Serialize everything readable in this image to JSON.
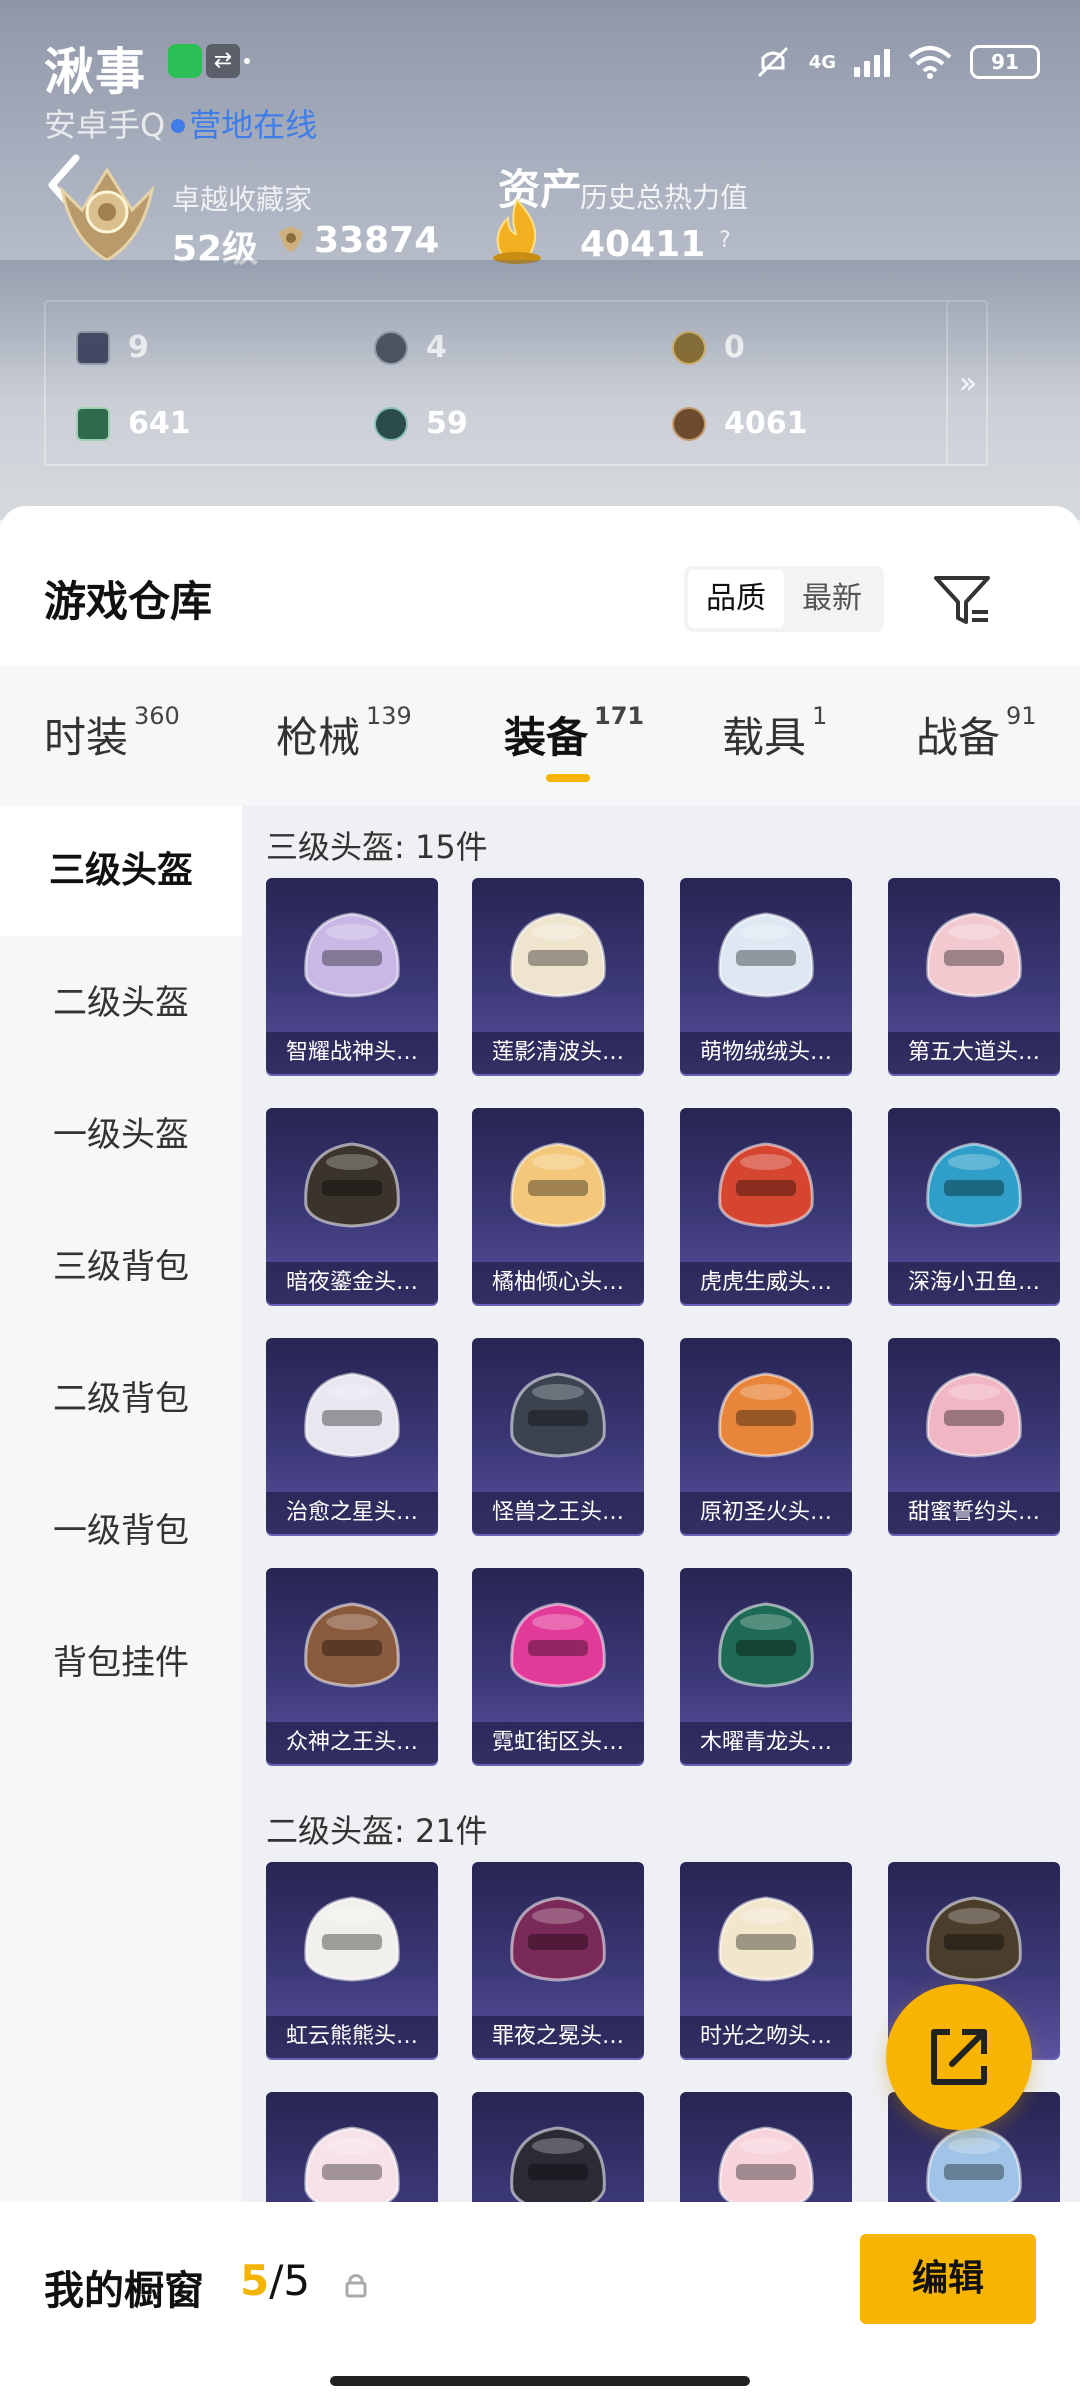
{
  "status_bar": {
    "clock": "湫事",
    "network": "4G",
    "battery": "91"
  },
  "header": {
    "account": "安卓手Q",
    "online": "营地在线",
    "rank_title": "卓越收藏家",
    "rank_level": "52级",
    "rank_score": "33874",
    "asset_title": "资产",
    "heat_title": "历史总热力值",
    "heat_value": "40411",
    "help": "?"
  },
  "inventory": [
    {
      "icon": "card-icon",
      "value": "9"
    },
    {
      "icon": "token-icon",
      "value": "4"
    },
    {
      "icon": "coin-icon",
      "value": "0"
    },
    {
      "icon": "ticket-icon",
      "value": "641"
    },
    {
      "icon": "orb-icon",
      "value": "59"
    },
    {
      "icon": "medal-icon",
      "value": "4061"
    }
  ],
  "inventory_more": "»",
  "warehouse": {
    "title": "游戏仓库",
    "sort_options": [
      "品质",
      "最新"
    ],
    "sort_selected": "品质"
  },
  "tabs": [
    {
      "label": "时装",
      "count": "360"
    },
    {
      "label": "枪械",
      "count": "139"
    },
    {
      "label": "装备",
      "count": "171",
      "selected": true
    },
    {
      "label": "载具",
      "count": "1"
    },
    {
      "label": "战备",
      "count": "91"
    }
  ],
  "categories": [
    "三级头盔",
    "二级头盔",
    "一级头盔",
    "三级背包",
    "二级背包",
    "一级背包",
    "背包挂件"
  ],
  "sections": [
    {
      "title": "三级头盔: 15件",
      "items": [
        {
          "label": "智耀战神头…",
          "color": "#c9b8e6"
        },
        {
          "label": "莲影清波头…",
          "color": "#efe5cf"
        },
        {
          "label": "萌物绒绒头…",
          "color": "#dde8f2"
        },
        {
          "label": "第五大道头…",
          "color": "#f2c9cf"
        },
        {
          "label": "暗夜鎏金头…",
          "color": "#3a342c"
        },
        {
          "label": "橘柚倾心头…",
          "color": "#f4c87a"
        },
        {
          "label": "虎虎生威头…",
          "color": "#d54530"
        },
        {
          "label": "深海小丑鱼…",
          "color": "#2f9fc9"
        },
        {
          "label": "治愈之星头…",
          "color": "#e9e6f0"
        },
        {
          "label": "怪兽之王头…",
          "color": "#3b4350"
        },
        {
          "label": "原初圣火头…",
          "color": "#e8853a"
        },
        {
          "label": "甜蜜誓约头…",
          "color": "#f0b6c4"
        },
        {
          "label": "众神之王头…",
          "color": "#8a5a3c"
        },
        {
          "label": "霓虹街区头…",
          "color": "#e23a98"
        },
        {
          "label": "木曜青龙头…",
          "color": "#1f6a55"
        }
      ]
    },
    {
      "title": "二级头盔: 21件",
      "items": [
        {
          "label": "虹云熊熊头…",
          "color": "#f2f0ec"
        },
        {
          "label": "罪夜之冕头…",
          "color": "#7a2a58"
        },
        {
          "label": "时光之吻头…",
          "color": "#f2e6cc"
        },
        {
          "label": "",
          "color": "#4a3d2c"
        },
        {
          "label": "",
          "color": "#f7e2ea"
        },
        {
          "label": "",
          "color": "#2b2b36"
        },
        {
          "label": "",
          "color": "#f7d4dc"
        },
        {
          "label": "",
          "color": "#9fc4e8"
        }
      ]
    }
  ],
  "showcase": {
    "label": "我的橱窗",
    "current": "5",
    "total": "/5",
    "edit": "编辑"
  }
}
